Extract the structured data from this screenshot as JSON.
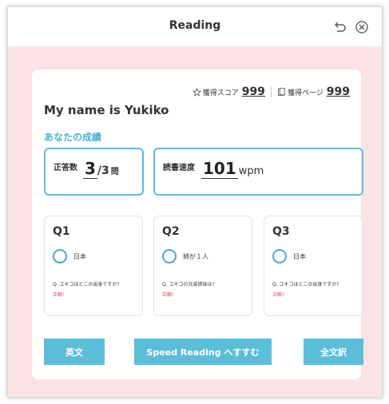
{
  "window": {
    "title": "Reading"
  },
  "icons": {
    "back": "undo-arrow-icon",
    "close": "circle-x-icon",
    "star": "star-outline-icon",
    "page": "page-icon"
  },
  "colors": {
    "accent": "#5cbdd8",
    "background": "#fbe3e5",
    "correct": "#e2433b"
  },
  "scores": {
    "score_label": "獲得スコア",
    "score_value": "999",
    "page_label": "獲得ページ",
    "page_value": "999"
  },
  "user_title": "My name is Yukiko",
  "section_title": "あなたの成績",
  "correct_box": {
    "label": "正答数",
    "value": "3",
    "fraction": "/3",
    "unit": "問"
  },
  "speed_box": {
    "label": "読書速度",
    "value": "101",
    "unit": "wpm"
  },
  "questions": [
    {
      "label": "Q1",
      "option": "日本",
      "question": "Q. ユキコはどこの出身ですか?",
      "result": "正解!"
    },
    {
      "label": "Q2",
      "option": "姉が１人",
      "question": "Q. ユキコの兄弟姉妹は?",
      "result": "正解!"
    },
    {
      "label": "Q3",
      "option": "日本",
      "question": "Q. ユキコはどこの出身ですか?",
      "result": "正解!"
    }
  ],
  "buttons": {
    "english": "英文",
    "speed_reading": "Speed Reading へすすむ",
    "full_translation": "全文訳"
  }
}
